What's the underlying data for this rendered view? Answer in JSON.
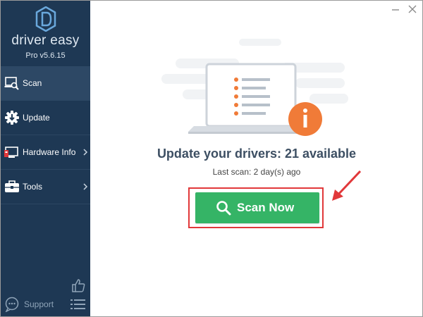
{
  "app": {
    "brand": "driver easy",
    "version": "Pro v5.6.15"
  },
  "sidebar": {
    "items": [
      {
        "label": "Scan",
        "icon": "scan-icon",
        "active": true
      },
      {
        "label": "Update",
        "icon": "update-gear-icon",
        "active": false
      },
      {
        "label": "Hardware Info",
        "icon": "hardware-info-icon",
        "active": false
      },
      {
        "label": "Tools",
        "icon": "toolbox-icon",
        "active": false
      }
    ],
    "support_label": "Support"
  },
  "main": {
    "headline": "Update your drivers: 21 available",
    "last_scan": "Last scan: 2 day(s) ago",
    "scan_button": "Scan Now"
  },
  "colors": {
    "sidebar_bg": "#1e3854",
    "sidebar_active": "#2d4865",
    "scan_button": "#35b466",
    "highlight": "#e1383a",
    "info_badge": "#f07b38"
  }
}
